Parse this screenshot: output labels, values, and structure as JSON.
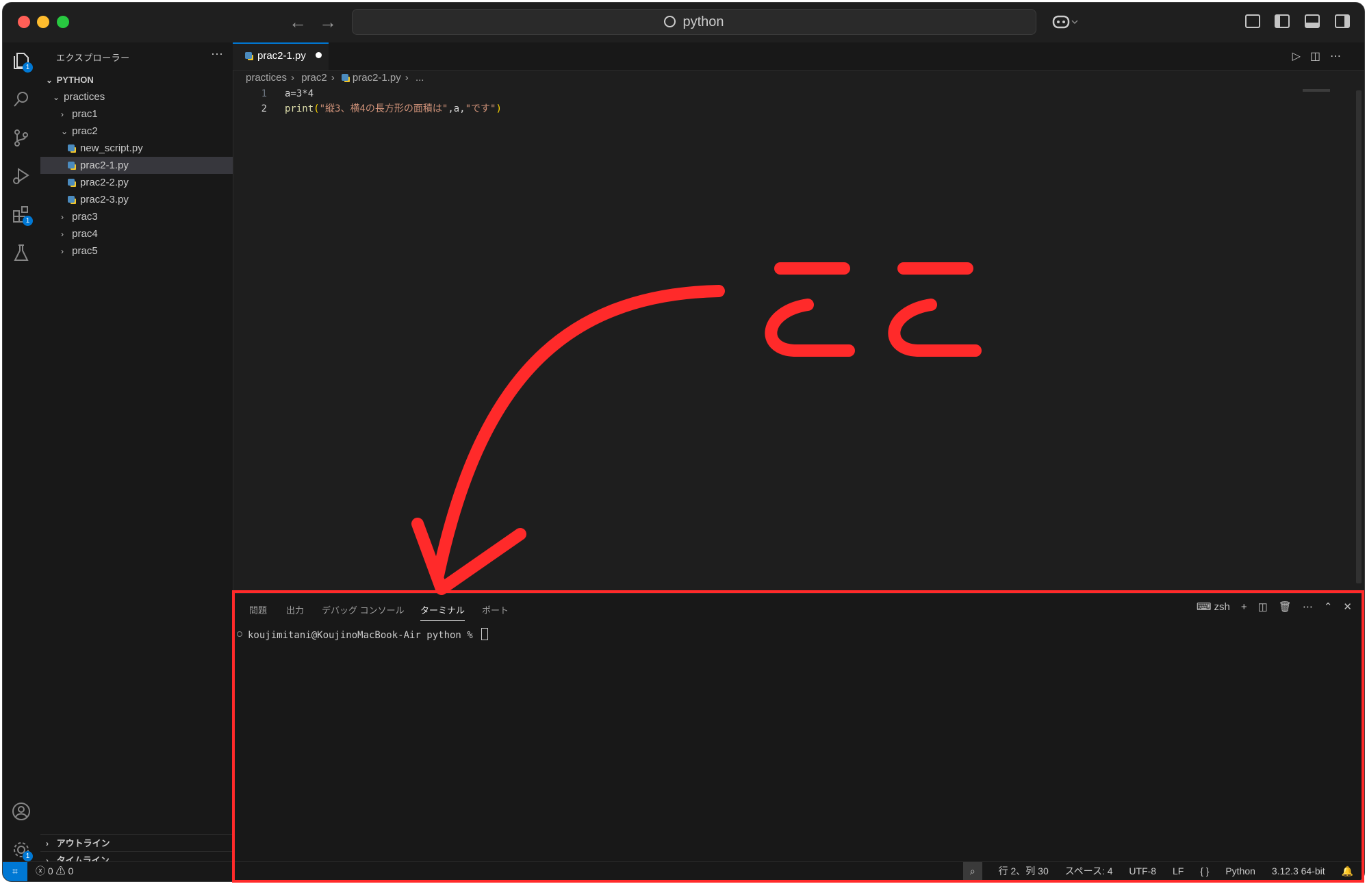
{
  "titlebar": {
    "search_text": "python",
    "nav_back": "←",
    "nav_forward": "→"
  },
  "activity_bar": {
    "explorer_badge": "1",
    "extensions_badge": "1",
    "settings_badge": "1"
  },
  "sidebar": {
    "title": "エクスプローラー",
    "more": "···",
    "root": "PYTHON",
    "items": [
      {
        "label": "practices",
        "kind": "folder-open",
        "depth": 1
      },
      {
        "label": "prac1",
        "kind": "folder-closed",
        "depth": 2
      },
      {
        "label": "prac2",
        "kind": "folder-open",
        "depth": 2
      },
      {
        "label": "new_script.py",
        "kind": "file",
        "depth": 3
      },
      {
        "label": "prac2-1.py",
        "kind": "file",
        "depth": 3,
        "selected": true
      },
      {
        "label": "prac2-2.py",
        "kind": "file",
        "depth": 3
      },
      {
        "label": "prac2-3.py",
        "kind": "file",
        "depth": 3
      },
      {
        "label": "prac3",
        "kind": "folder-closed",
        "depth": 2
      },
      {
        "label": "prac4",
        "kind": "folder-closed",
        "depth": 2
      },
      {
        "label": "prac5",
        "kind": "folder-closed",
        "depth": 2
      }
    ],
    "outline": "アウトライン",
    "timeline": "タイムライン"
  },
  "editor": {
    "tab_label": "prac2-1.py",
    "breadcrumb": [
      "practices",
      "prac2",
      "prac2-1.py",
      "..."
    ],
    "lines": [
      {
        "num": "1",
        "text": "a=3*4"
      },
      {
        "num": "2",
        "fn": "print",
        "open": "(",
        "str1": "\"縦3、横4の長方形の面積は\"",
        "mid": ",a,",
        "str2": "\"です\"",
        "close": ")"
      }
    ]
  },
  "panel": {
    "tabs": [
      "問題",
      "出力",
      "デバッグ コンソール",
      "ターミナル",
      "ポート"
    ],
    "active_tab": "ターミナル",
    "shell": "zsh",
    "prompt": "koujimitani@KoujinoMacBook-Air python % "
  },
  "statusbar": {
    "errors": "0",
    "warnings": "0",
    "position": "行 2、列 30",
    "spaces": "スペース: 4",
    "encoding": "UTF-8",
    "eol": "LF",
    "language": "Python",
    "interpreter": "3.12.3 64-bit"
  },
  "annotation": {
    "text": "ここ",
    "color": "#ff2a2a"
  }
}
